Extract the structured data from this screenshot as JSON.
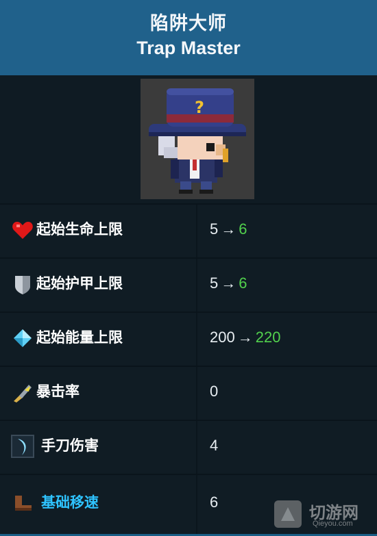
{
  "header": {
    "title_cn": "陷阱大师",
    "title_en": "Trap Master"
  },
  "portrait": {
    "alt": ""
  },
  "stats": [
    {
      "icon": "heart-icon",
      "label": "起始生命上限",
      "old": "5",
      "arrow": "→",
      "new": "6",
      "highlight": false
    },
    {
      "icon": "shield-icon",
      "label": "起始护甲上限",
      "old": "5",
      "arrow": "→",
      "new": "6",
      "highlight": false
    },
    {
      "icon": "crystal-icon",
      "label": "起始能量上限",
      "old": "200",
      "arrow": "→",
      "new": "220",
      "highlight": false
    },
    {
      "icon": "crit-icon",
      "label": "暴击率",
      "value": "0",
      "highlight": false
    },
    {
      "icon": "slash-icon",
      "label": "手刀伤害",
      "value": "4",
      "highlight": false
    },
    {
      "icon": "boot-icon",
      "label": "基础移速",
      "value": "6",
      "highlight": true
    }
  ],
  "watermark": {
    "text": "切游网",
    "sub": "Qieyou.com"
  },
  "colors": {
    "header_bg": "#20618b",
    "body_bg": "#0f1b23",
    "new_value": "#52d14d",
    "link_label": "#2ec3ff"
  }
}
